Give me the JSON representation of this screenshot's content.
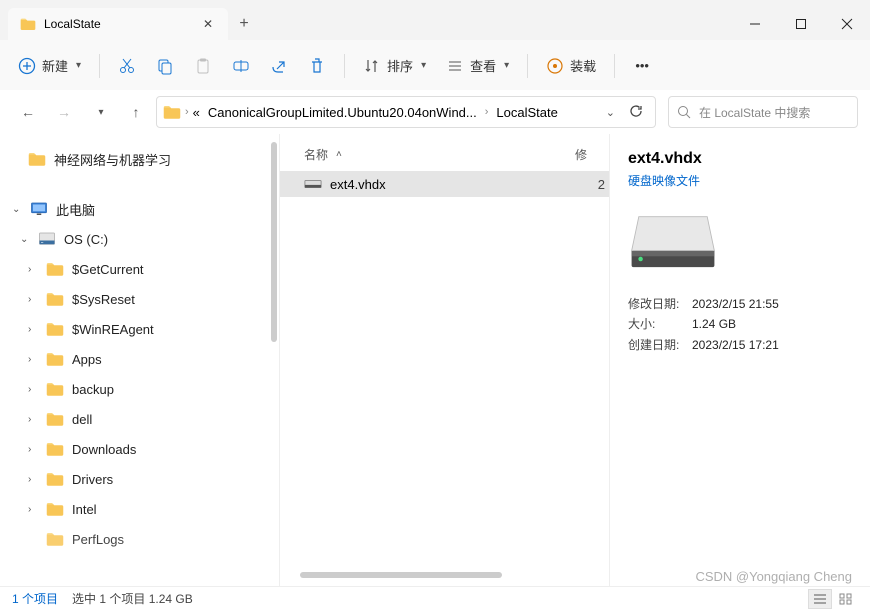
{
  "tab": {
    "title": "LocalState"
  },
  "toolbar": {
    "new_label": "新建",
    "sort_label": "排序",
    "view_label": "查看",
    "mount_label": "装载"
  },
  "breadcrumb": {
    "path1": "CanonicalGroupLimited.Ubuntu20.04onWind...",
    "path2": "LocalState"
  },
  "search": {
    "placeholder": "在 LocalState 中搜索"
  },
  "sidebar": {
    "fav1": "神经网络与机器学习",
    "this_pc": "此电脑",
    "os_drive": "OS (C:)",
    "folders": [
      "$GetCurrent",
      "$SysReset",
      "$WinREAgent",
      "Apps",
      "backup",
      "dell",
      "Downloads",
      "Drivers",
      "Intel",
      "PerfLogs"
    ]
  },
  "columns": {
    "name": "名称",
    "date_cut": "修"
  },
  "file": {
    "name": "ext4.vhdx",
    "date_edge": "2"
  },
  "details": {
    "title": "ext4.vhdx",
    "type": "硬盘映像文件",
    "modified_k": "修改日期:",
    "modified_v": "2023/2/15 21:55",
    "size_k": "大小:",
    "size_v": "1.24 GB",
    "created_k": "创建日期:",
    "created_v": "2023/2/15 17:21"
  },
  "status": {
    "count": "1 个项目",
    "selected": "选中 1 个项目  1.24 GB"
  },
  "watermark": "CSDN @Yongqiang Cheng"
}
